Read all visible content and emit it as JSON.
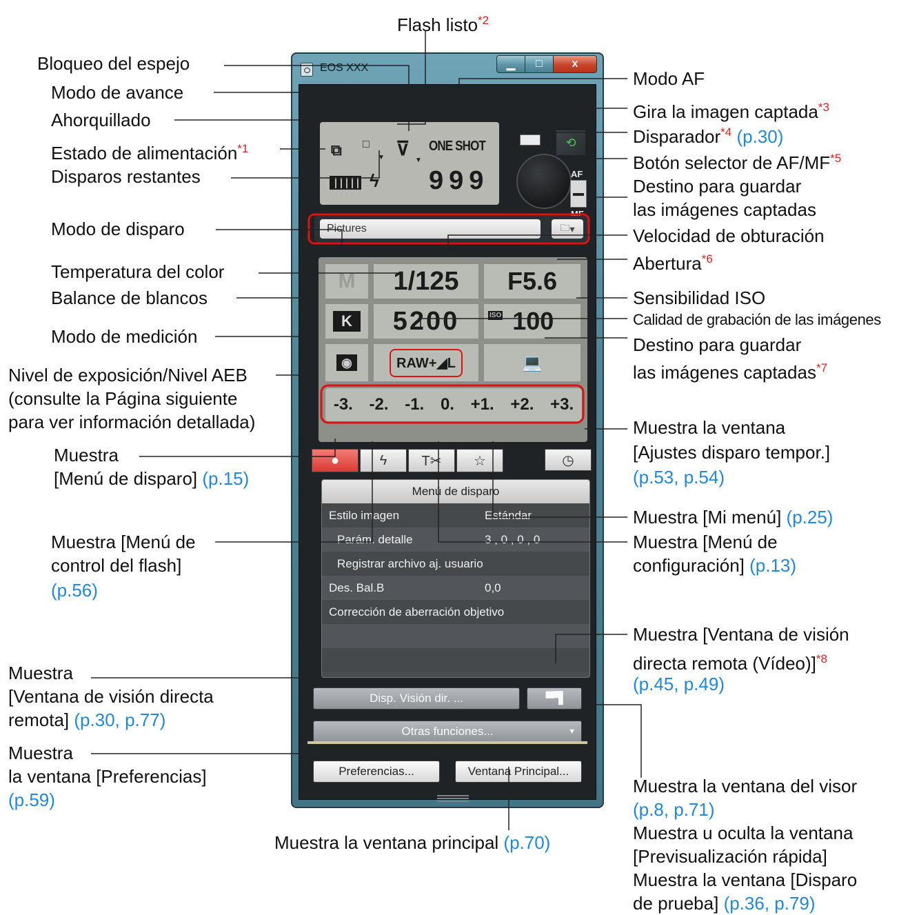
{
  "window": {
    "title": "EOS XXX",
    "buttons": {
      "minimize": "▁",
      "maximize": "□",
      "close": "x"
    }
  },
  "lcd": {
    "af_mode": "ONE SHOT",
    "shots_remaining": "999",
    "flash_symbol": "ϟ"
  },
  "afmf": {
    "top": "AF",
    "bottom": "MF"
  },
  "destination": {
    "folder": "Pictures",
    "folder_btn": "▾"
  },
  "settings": {
    "shooting_mode": "M",
    "shutter_speed": "1/125",
    "aperture": "F5.6",
    "wb": "K",
    "color_temp": "5200",
    "iso_tag": "ISO",
    "iso": "100",
    "quality": "RAW+◢L",
    "exposure_scale": [
      "-3.",
      "-2.",
      "-1.",
      "0.",
      "+1.",
      "+2.",
      "+3."
    ]
  },
  "tabs": [
    {
      "name": "shooting",
      "glyph": "●"
    },
    {
      "name": "flash",
      "glyph": "ϟ"
    },
    {
      "name": "setup",
      "glyph": "T✂"
    },
    {
      "name": "my-menu",
      "glyph": "☆"
    }
  ],
  "timer_glyph": "◷",
  "menu": {
    "header": "Menú de disparo",
    "rows": [
      {
        "label": "Estilo imagen",
        "value": "Estándar"
      },
      {
        "label": "Parám. detalle",
        "value": "3 , 0 , 0 , 0"
      },
      {
        "label": "Registrar archivo aj. usuario",
        "value": ""
      },
      {
        "label": "Des. Bal.B",
        "value": "0,0"
      },
      {
        "label": "Corrección de aberración objetivo",
        "value": ""
      }
    ]
  },
  "buttons": {
    "live_view": "Disp. Visión dir. ...",
    "movie_glyph": "▀▜",
    "other_functions": "Otras funciones...",
    "other_arrow": "▼",
    "preferences": "Preferencias...",
    "main_window": "Ventana Principal..."
  },
  "annotations": {
    "flash_ready": "Flash listo",
    "flash_ready_star": "*2",
    "mirror_lockup": "Bloqueo del espejo",
    "drive_mode": "Modo de avance",
    "bracketing": "Ahorquillado",
    "power_status": "Estado de alimentación",
    "power_status_star": "*1",
    "shots_remaining": "Disparos restantes",
    "af_mode": "Modo AF",
    "rotate_image": "Gira la imagen captada",
    "rotate_image_star": "*3",
    "shutter": "Disparador",
    "shutter_star": "*4",
    "shutter_ref": "(p.30)",
    "afmf_switch": "Botón selector de AF/MF",
    "afmf_switch_star": "*5",
    "dest1_l1": "Destino para guardar",
    "dest1_l2": "las imágenes captadas",
    "shooting_mode": "Modo de disparo",
    "shutter_speed": "Velocidad de obturación",
    "aperture": "Abertura",
    "aperture_star": "*6",
    "color_temp": "Temperatura del color",
    "white_balance": "Balance de blancos",
    "iso": "Sensibilidad ISO",
    "quality": "Calidad de grabación de las imágenes",
    "metering": "Modo de medición",
    "dest2_l1": "Destino para guardar",
    "dest2_l2": "las imágenes captadas",
    "dest2_star": "*7",
    "exposure_l1": "Nivel de exposición/Nivel AEB",
    "exposure_l2": "(consulte la Página siguiente",
    "exposure_l3": "para ver información detallada)",
    "show_shoot_l1": "Muestra",
    "show_shoot_l2": "[Menú de disparo]",
    "show_shoot_ref": "(p.15)",
    "timer_l1": "Muestra la ventana",
    "timer_l2": "[Ajustes disparo tempor.]",
    "timer_ref": "(p.53, p.54)",
    "mymenu": "Muestra [Mi menú]",
    "mymenu_ref": "(p.25)",
    "flashmenu_l1": "Muestra [Menú de",
    "flashmenu_l2": "control del flash]",
    "flashmenu_ref": "(p.56)",
    "setup_l1": "Muestra [Menú de",
    "setup_l2": "configuración]",
    "setup_ref": "(p.13)",
    "movie_l1": "Muestra [Ventana de visión",
    "movie_l2": "directa remota (Vídeo)]",
    "movie_star": "*8",
    "movie_ref": "(p.45, p.49)",
    "liveview_l1": "Muestra",
    "liveview_l2": "[Ventana de visión directa",
    "liveview_l3": "remota]",
    "liveview_ref": "(p.30, p.77)",
    "prefs_l1": "Muestra",
    "prefs_l2": "la ventana [Preferencias]",
    "prefs_ref": "(p.59)",
    "mainwin": "Muestra la ventana principal",
    "mainwin_ref": "(p.70)",
    "other_l1": "Muestra la ventana del visor",
    "other_l1_ref": "(p.8, p.71)",
    "other_l2": "Muestra u oculta la ventana",
    "other_l3": "[Previsualización rápida]",
    "other_l4": "Muestra la ventana [Disparo",
    "other_l5": "de prueba]",
    "other_l5_ref": "(p.36, p.79)"
  }
}
